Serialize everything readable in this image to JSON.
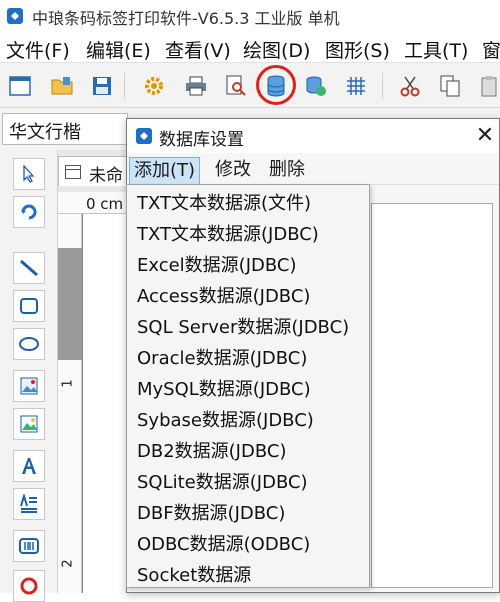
{
  "app": {
    "title": "中琅条码标签打印软件-V6.5.3 工业版 单机"
  },
  "menubar": {
    "items": [
      {
        "label": "文件(F)"
      },
      {
        "label": "编辑(E)"
      },
      {
        "label": "查看(V)"
      },
      {
        "label": "绘图(D)"
      },
      {
        "label": "图形(S)"
      },
      {
        "label": "工具(T)"
      },
      {
        "label": "窗"
      }
    ]
  },
  "toolbar": {
    "icons": [
      "new-window-icon",
      "open-folder-icon",
      "save-icon",
      "settings-icon",
      "print-icon",
      "print-preview-icon",
      "database-icon",
      "database-refresh-icon",
      "grid-icon",
      "cut-icon",
      "copy-icon",
      "paste-icon"
    ],
    "highlight_color": "#e0201c"
  },
  "fontbar": {
    "font_name": "华文行楷"
  },
  "document": {
    "tab_label": "未命",
    "ruler_top_label": "0 cm",
    "ruler_left_labels": [
      "1",
      "2"
    ]
  },
  "dialog": {
    "title": "数据库设置",
    "close_glyph": "✕",
    "menus": [
      {
        "label": "添加(T)"
      },
      {
        "label": "修改"
      },
      {
        "label": "删除"
      }
    ]
  },
  "dropdown": {
    "items": [
      "TXT文本数据源(文件)",
      "TXT文本数据源(JDBC)",
      "Excel数据源(JDBC)",
      "Access数据源(JDBC)",
      "SQL Server数据源(JDBC)",
      "Oracle数据源(JDBC)",
      "MySQL数据源(JDBC)",
      "Sybase数据源(JDBC)",
      "DB2数据源(JDBC)",
      "SQLite数据源(JDBC)",
      "DBF数据源(JDBC)",
      "ODBC数据源(ODBC)",
      "Socket数据源"
    ]
  },
  "colors": {
    "accent": "#1f6fc4",
    "menu_active_bg": "#cce4f7"
  }
}
